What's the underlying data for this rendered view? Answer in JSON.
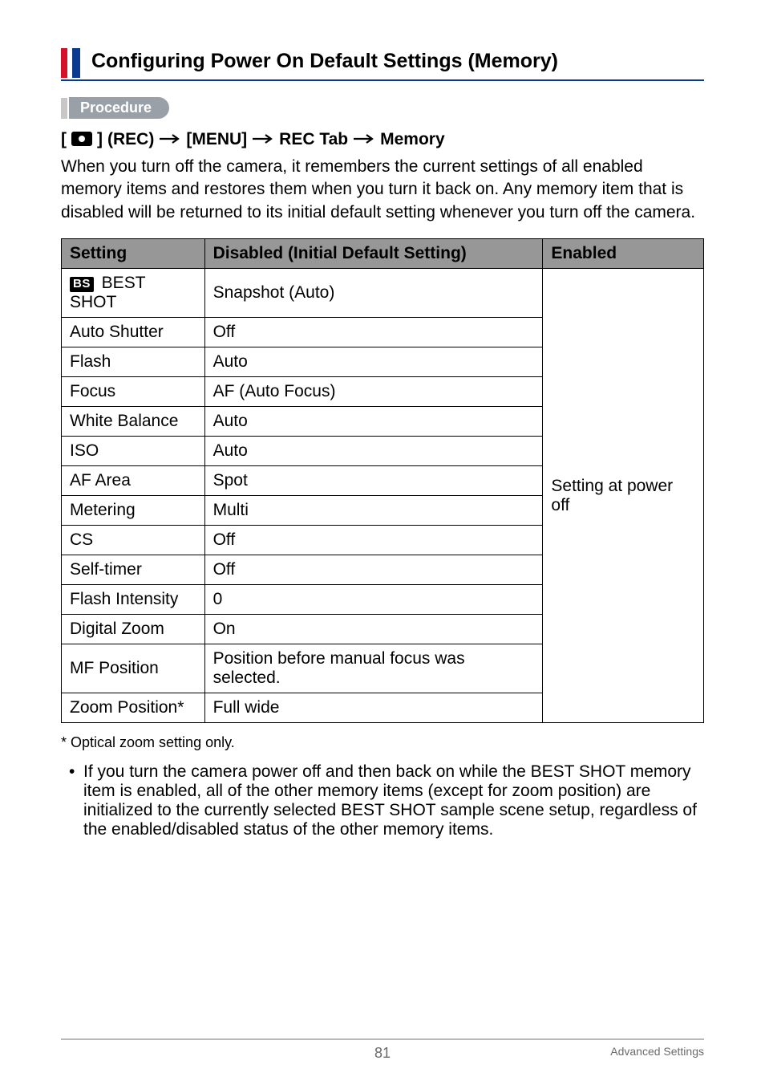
{
  "section_title": "Configuring Power On Default Settings (Memory)",
  "procedure_label": "Procedure",
  "path": {
    "bracket_open": "[",
    "bracket_close": "]",
    "rec_label": " (REC) ",
    "menu": "[MENU]",
    "rec_tab": "REC Tab",
    "memory": "Memory"
  },
  "body_text": "When you turn off the camera, it remembers the current settings of all enabled memory items and restores them when you turn it back on. Any memory item that is disabled will be returned to its initial default setting whenever you turn off the camera.",
  "table": {
    "headers": {
      "setting": "Setting",
      "disabled": "Disabled (Initial Default Setting)",
      "enabled": "Enabled"
    },
    "bs_badge": "BS",
    "rows": [
      {
        "setting": " BEST SHOT",
        "disabled": "Snapshot (Auto)",
        "bs": true
      },
      {
        "setting": "Auto Shutter",
        "disabled": "Off"
      },
      {
        "setting": "Flash",
        "disabled": "Auto"
      },
      {
        "setting": "Focus",
        "disabled": "AF (Auto Focus)"
      },
      {
        "setting": "White Balance",
        "disabled": "Auto"
      },
      {
        "setting": "ISO",
        "disabled": "Auto"
      },
      {
        "setting": "AF Area",
        "disabled": "Spot"
      },
      {
        "setting": "Metering",
        "disabled": "Multi"
      },
      {
        "setting": "CS",
        "disabled": "Off"
      },
      {
        "setting": "Self-timer",
        "disabled": "Off"
      },
      {
        "setting": "Flash Intensity",
        "disabled": "0"
      },
      {
        "setting": "Digital Zoom",
        "disabled": "On"
      },
      {
        "setting": "MF Position",
        "disabled": "Position before manual focus was selected."
      },
      {
        "setting": "Zoom Position*",
        "disabled": "Full wide"
      }
    ],
    "enabled_text": "Setting at power off"
  },
  "footnote": "* Optical zoom setting only.",
  "bullet": "If you turn the camera power off and then back on while the BEST SHOT memory item is enabled, all of the other memory items (except for zoom position) are initialized to the currently selected BEST SHOT sample scene setup, regardless of the enabled/disabled status of the other memory items.",
  "footer": {
    "page": "81",
    "section": "Advanced Settings"
  }
}
